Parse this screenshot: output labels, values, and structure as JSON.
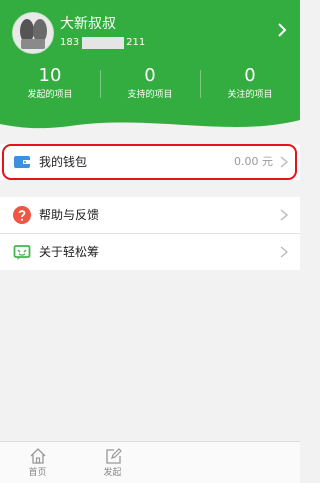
{
  "profile": {
    "name": "大新叔叔",
    "phone_prefix": "183",
    "phone_suffix": "211"
  },
  "stats": [
    {
      "value": "10",
      "label": "发起的项目"
    },
    {
      "value": "0",
      "label": "支持的项目"
    },
    {
      "value": "0",
      "label": "关注的项目"
    }
  ],
  "menu": {
    "wallet": {
      "label": "我的钱包",
      "value": "0.00 元"
    },
    "help": {
      "label": "帮助与反馈"
    },
    "about": {
      "label": "关于轻松筹"
    }
  },
  "tabbar": [
    {
      "label": "首页",
      "icon": "home-icon"
    },
    {
      "label": "发起",
      "icon": "compose-icon"
    }
  ],
  "colors": {
    "brand_green": "#33ad3f",
    "highlight_red": "#e8121b",
    "help_icon_red": "#f05545",
    "wallet_icon_blue": "#3d8fe0",
    "about_icon_green": "#46b54c"
  }
}
